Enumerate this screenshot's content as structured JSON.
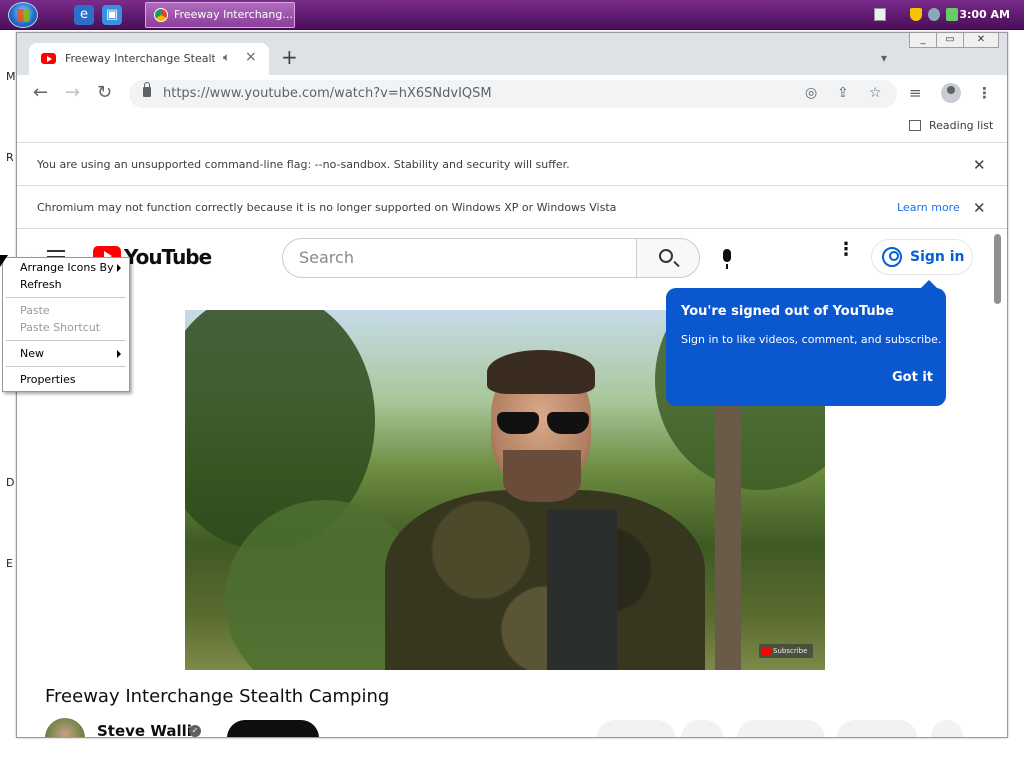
{
  "taskbar": {
    "active_task": "Freeway Interchang...",
    "clock": "3:00 AM"
  },
  "desktop": {
    "edge_letters": [
      "M",
      "R",
      "D",
      "E"
    ]
  },
  "browser": {
    "tab": {
      "title": "Freeway Interchange Stealth Ca",
      "speaker_icon": "speaker-icon",
      "close": "×"
    },
    "new_tab": "+",
    "url": "https://www.youtube.com/watch?v=hX6SNdvIQSM",
    "reading_list": "Reading list",
    "infobars": [
      {
        "message": "You are using an unsupported command-line flag: --no-sandbox. Stability and security will suffer.",
        "link": ""
      },
      {
        "message": "Chromium may not function correctly because it is no longer supported on Windows XP or Windows Vista",
        "link": "Learn more"
      }
    ]
  },
  "youtube": {
    "logo_text": "YouTube",
    "search_placeholder": "Search",
    "sign_in": "Sign in",
    "tooltip": {
      "title": "You're signed out of YouTube",
      "body": "Sign in to like videos, comment, and subscribe.",
      "button": "Got it"
    },
    "video_watermark": "Subscribe",
    "video_title": "Freeway Interchange Stealth Camping",
    "channel_name": "Steve Wallis"
  },
  "context_menu": {
    "items": [
      {
        "label": "Arrange Icons By",
        "submenu": true,
        "disabled": false
      },
      {
        "label": "Refresh",
        "submenu": false,
        "disabled": false
      },
      {
        "label": "Paste",
        "submenu": false,
        "disabled": true
      },
      {
        "label": "Paste Shortcut",
        "submenu": false,
        "disabled": true
      },
      {
        "label": "New",
        "submenu": true,
        "disabled": false
      },
      {
        "label": "Properties",
        "submenu": false,
        "disabled": false
      }
    ]
  },
  "colors": {
    "taskbar": "#5e1a6e",
    "tooltip": "#0b57d0",
    "youtube_red": "#ff0000",
    "link_blue": "#065fd4"
  }
}
